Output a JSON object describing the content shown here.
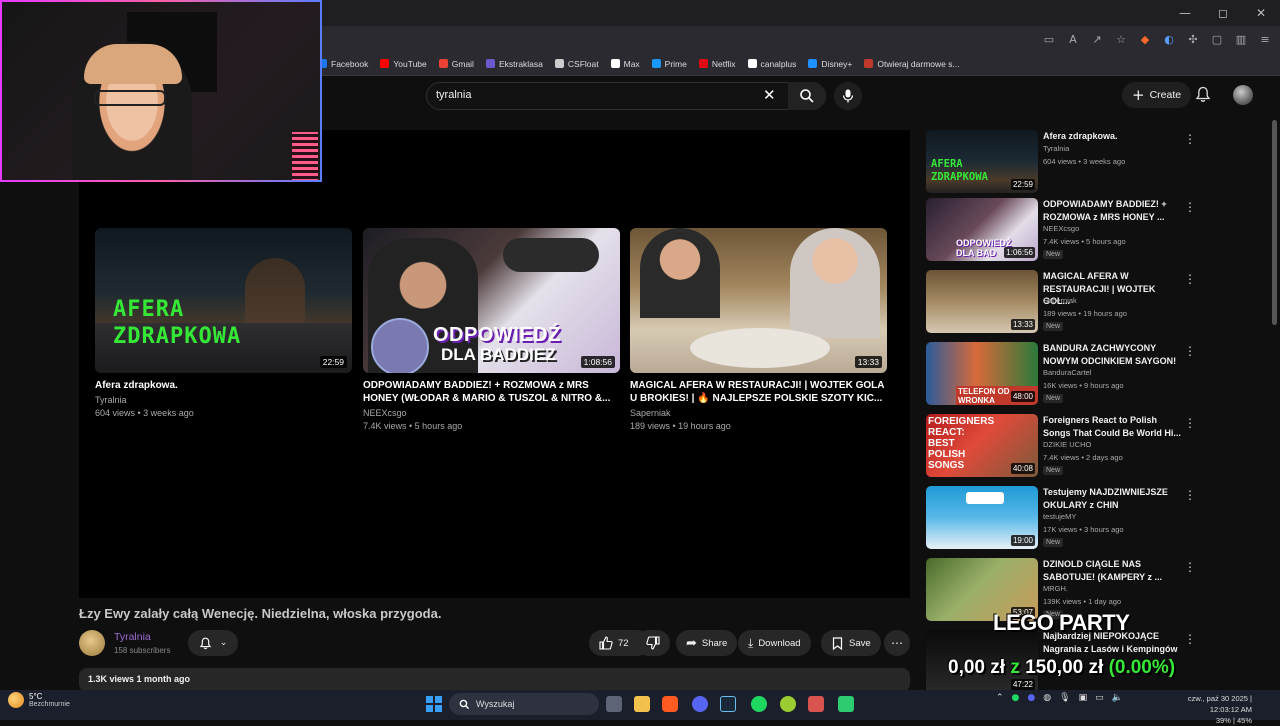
{
  "browser": {
    "window_controls": [
      "—",
      "◻",
      "✕"
    ],
    "bookmarks": [
      {
        "label": "Facebook",
        "color": "#1877f2"
      },
      {
        "label": "YouTube",
        "color": "#ff0000"
      },
      {
        "label": "Gmail",
        "color": "#ea4335"
      },
      {
        "label": "Ekstraklasa",
        "color": "#6a5acd"
      },
      {
        "label": "CSFloat",
        "color": "#cccccc"
      },
      {
        "label": "Max",
        "color": "#ffffff"
      },
      {
        "label": "Prime",
        "color": "#1a98ff"
      },
      {
        "label": "Netflix",
        "color": "#e50914"
      },
      {
        "label": "canalplus",
        "color": "#ffffff"
      },
      {
        "label": "Disney+",
        "color": "#1e90ff"
      },
      {
        "label": "Otwieraj darmowe s...",
        "color": "#c0392b"
      }
    ]
  },
  "header": {
    "search_query": "tyralnia",
    "clear_icon": "✕",
    "create_label": "Create"
  },
  "end_cards": [
    {
      "title": "Afera zdrapkowa.",
      "channel": "Tyralnia",
      "meta": "604 views • 3 weeks ago",
      "duration": "22:59",
      "thumb_text": "AFERA\nZDRAPKOWA"
    },
    {
      "title": "ODPOWIADAMY BADDIEZ! + ROZMOWA z MRS HONEY (WŁODAR & MARIO & TUSZOL & NITRO &...",
      "channel": "NEEXcsgo",
      "meta": "7.4K views • 5 hours ago",
      "duration": "1:08:56",
      "thumb_text1": "ODPOWIEDŹ",
      "thumb_text2": "DLA BADDIEZ"
    },
    {
      "title": "MAGICAL AFERA W RESTAURACJI! | WOJTEK GOLA U BROKIES! | 🔥 NAJLEPSZE POLSKIE SZOTY KIC...",
      "channel": "Saperniak",
      "meta": "189 views • 19 hours ago",
      "duration": "13:33"
    }
  ],
  "video": {
    "title": "Łzy Ewy zalały całą Wenecję. Niedzielna, włoska przygoda.",
    "channel": "Tyralnia",
    "subscribers": "158 subscribers",
    "likes": "72",
    "share_label": "Share",
    "download_label": "Download",
    "save_label": "Save",
    "description_meta": "1.3K views  1 month ago"
  },
  "sidebar": [
    {
      "title": "Afera zdrapkowa.",
      "channel": "Tyralnia",
      "meta": "604 views • 3 weeks ago",
      "duration": "22:59",
      "new": ""
    },
    {
      "title": "ODPOWIADAMY BADDIEZ! + ROZMOWA z MRS HONEY ...",
      "channel": "NEEXcsgo",
      "meta": "7.4K views • 5 hours ago",
      "duration": "1:06:56",
      "new": "New"
    },
    {
      "title": "MAGICAL AFERA  W RESTAURACJI! | WOJTEK GOL...",
      "channel": "Saperniak",
      "meta": "189 views • 19 hours ago",
      "duration": "13:33",
      "new": "New"
    },
    {
      "title": "BANDURA ZACHWYCONY NOWYM ODCINKIEM SAYGON!",
      "channel": "BanduraCartel",
      "meta": "16K views • 9 hours ago",
      "duration": "48:00",
      "new": "New"
    },
    {
      "title": "Foreigners React to Polish Songs That Could Be World Hi...",
      "channel": "DZIKIE UCHO",
      "meta": "7.4K views • 2 days ago",
      "duration": "40:08",
      "new": "New"
    },
    {
      "title": "Testujemy NAJDZIWNIEJSZE OKULARY z CHIN",
      "channel": "testujeMY",
      "meta": "17K views • 3 hours ago",
      "duration": "19:00",
      "new": "New"
    },
    {
      "title": "DZINOLD CIĄGLE NAS SABOTUJE! (KAMPERY z ...",
      "channel": "MRGH.",
      "meta": "139K views • 1 day ago",
      "duration": "53:07",
      "new": "New"
    },
    {
      "title": "Najbardziej NIEPOKOJĄCE Nagrania z Lasów i Kempingów",
      "channel": "",
      "meta": "",
      "duration": "47:22",
      "new": ""
    }
  ],
  "overlay": {
    "lego_title": "LEGO PARTY",
    "amount_current": "0,00 zł",
    "amount_sep": "z",
    "amount_goal": "150,00 zł",
    "percent": "(0.00%)"
  },
  "taskbar": {
    "temperature": "5°C",
    "weather_desc": "Bezchmurnie",
    "search_label": "Wyszukaj",
    "clock_line1": "czw., paź 30 2025 | 12:03:12 AM",
    "clock_line2": "39% | 45%"
  },
  "colors": {
    "accent_green": "#35e836",
    "channel_purple": "#9b6bd1",
    "yt_red": "#ff0000"
  }
}
